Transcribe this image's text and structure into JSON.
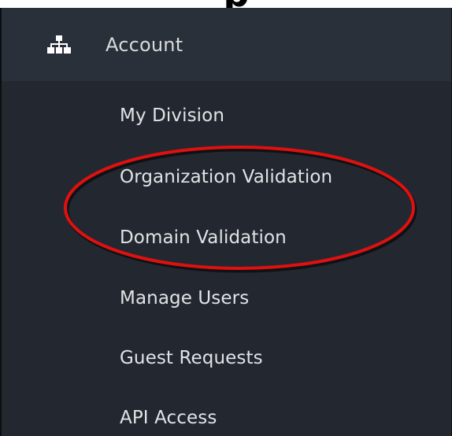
{
  "header": {
    "label": "Account",
    "icon": "sitemap-icon"
  },
  "menu": {
    "items": [
      {
        "label": "My Division"
      },
      {
        "label": "Organization Validation"
      },
      {
        "label": "Domain Validation"
      },
      {
        "label": "Manage Users"
      },
      {
        "label": "Guest Requests"
      },
      {
        "label": "API Access"
      }
    ]
  },
  "annotation": {
    "shape": "oval",
    "color": "#e01010",
    "encircles": [
      "Organization Validation",
      "Domain Validation"
    ]
  },
  "colors": {
    "panel_bg": "#232830",
    "header_bg": "#2a3039",
    "text": "#e1e3e6"
  }
}
